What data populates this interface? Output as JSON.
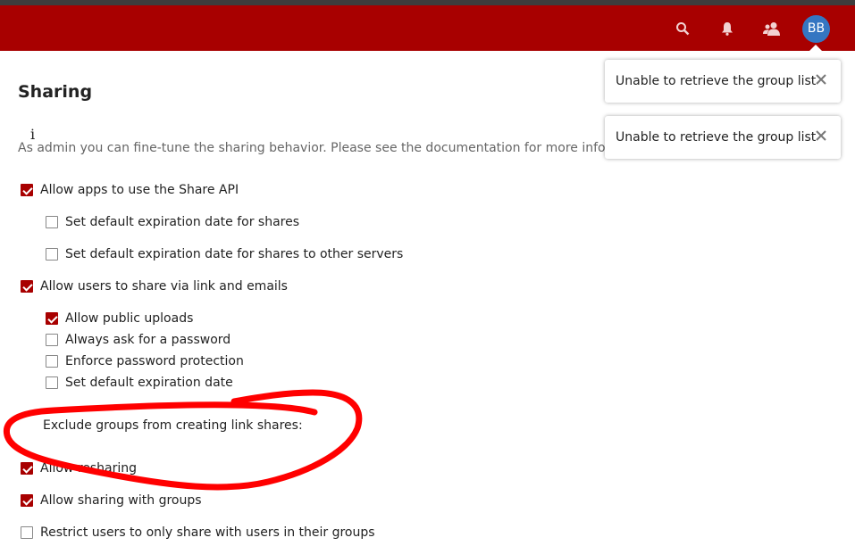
{
  "header": {
    "avatar_initials": "BB",
    "icons": [
      "search-icon",
      "bell-icon",
      "contacts-icon"
    ],
    "accent_color": "#a80000",
    "avatar_color": "#3576c2"
  },
  "notifications": [
    {
      "message": "Unable to retrieve the group list"
    },
    {
      "message": "Unable to retrieve the group list"
    }
  ],
  "sharing": {
    "title": "Sharing",
    "info_glyph": "i",
    "hint": "As admin you can fine-tune the sharing behavior. Please see the documentation for more information.",
    "options": {
      "share_api": {
        "label": "Allow apps to use the Share API",
        "checked": true
      },
      "default_expiration": {
        "label": "Set default expiration date for shares",
        "checked": false
      },
      "default_expiration_remote": {
        "label": "Set default expiration date for shares to other servers",
        "checked": false
      },
      "share_link": {
        "label": "Allow users to share via link and emails",
        "checked": true
      },
      "public_uploads": {
        "label": "Allow public uploads",
        "checked": true
      },
      "ask_password": {
        "label": "Always ask for a password",
        "checked": false
      },
      "enforce_password": {
        "label": "Enforce password protection",
        "checked": false
      },
      "link_expiration": {
        "label": "Set default expiration date",
        "checked": false
      },
      "exclude_groups_label": "Exclude groups from creating link shares:",
      "resharing": {
        "label": "Allow resharing",
        "checked": true
      },
      "group_sharing": {
        "label": "Allow sharing with groups",
        "checked": true
      },
      "restrict_groups": {
        "label": "Restrict users to only share with users in their groups",
        "checked": false
      }
    }
  }
}
